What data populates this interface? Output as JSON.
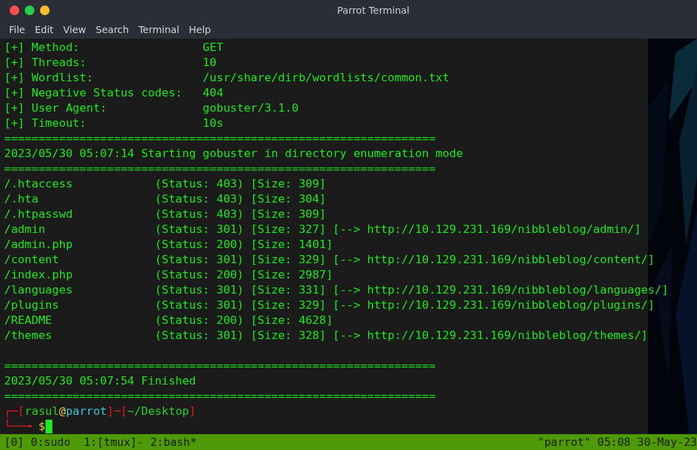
{
  "window": {
    "title": "Parrot Terminal",
    "controls": [
      {
        "color": "#ff5050"
      },
      {
        "color": "#23d24a"
      },
      {
        "color": "#fdbb2d"
      }
    ]
  },
  "menu": [
    "File",
    "Edit",
    "View",
    "Search",
    "Terminal",
    "Help"
  ],
  "output": [
    {
      "kind": "text",
      "text": "[+] Method:                  GET"
    },
    {
      "kind": "text",
      "text": "[+] Threads:                 10"
    },
    {
      "kind": "text",
      "text": "[+] Wordlist:                /usr/share/dirb/wordlists/common.txt"
    },
    {
      "kind": "text",
      "text": "[+] Negative Status codes:   404"
    },
    {
      "kind": "text",
      "text": "[+] User Agent:              gobuster/3.1.0"
    },
    {
      "kind": "text",
      "text": "[+] Timeout:                 10s"
    },
    {
      "kind": "text",
      "text": "==============================================================="
    },
    {
      "kind": "text",
      "text": "2023/05/30 05:07:14 Starting gobuster in directory enumeration mode"
    },
    {
      "kind": "text",
      "text": "==============================================================="
    },
    {
      "kind": "text",
      "text": "/.htaccess            (Status: 403) [Size: 309]"
    },
    {
      "kind": "text",
      "text": "/.hta                 (Status: 403) [Size: 304]"
    },
    {
      "kind": "text",
      "text": "/.htpasswd            (Status: 403) [Size: 309]"
    },
    {
      "kind": "text",
      "text": "/admin                (Status: 301) [Size: 327] [--> http://10.129.231.169/nibbleblog/admin/]"
    },
    {
      "kind": "text",
      "text": "/admin.php            (Status: 200) [Size: 1401]"
    },
    {
      "kind": "text",
      "text": "/content              (Status: 301) [Size: 329] [--> http://10.129.231.169/nibbleblog/content/]"
    },
    {
      "kind": "text",
      "text": "/index.php            (Status: 200) [Size: 2987]"
    },
    {
      "kind": "text",
      "text": "/languages            (Status: 301) [Size: 331] [--> http://10.129.231.169/nibbleblog/languages/]"
    },
    {
      "kind": "text",
      "text": "/plugins              (Status: 301) [Size: 329] [--> http://10.129.231.169/nibbleblog/plugins/]"
    },
    {
      "kind": "text",
      "text": "/README               (Status: 200) [Size: 4628]"
    },
    {
      "kind": "text",
      "text": "/themes               (Status: 301) [Size: 328] [--> http://10.129.231.169/nibbleblog/themes/]"
    },
    {
      "kind": "blank"
    },
    {
      "kind": "text",
      "text": "==============================================================="
    },
    {
      "kind": "text",
      "text": "2023/05/30 05:07:54 Finished"
    },
    {
      "kind": "text",
      "text": "==============================================================="
    }
  ],
  "prompt": {
    "segments": [
      {
        "text": "┌─[",
        "color": "#e01b1b"
      },
      {
        "text": "rasul",
        "color": "#2ad12a"
      },
      {
        "text": "@",
        "color": "#e8c84a"
      },
      {
        "text": "parrot",
        "color": "#3ac8d8"
      },
      {
        "text": "]─[",
        "color": "#e01b1b"
      },
      {
        "text": "~/Desktop",
        "color": "#2ad12a"
      },
      {
        "text": "]",
        "color": "#e01b1b"
      }
    ],
    "second_line": [
      {
        "text": "└──╼ ",
        "color": "#e01b1b"
      },
      {
        "text": "$",
        "color": "#e8c84a"
      }
    ]
  },
  "status_bar": {
    "left": "[0] 0:sudo  1:[tmux]- 2:bash*",
    "right": "\"parrot\" 05:08 30-May-23"
  }
}
